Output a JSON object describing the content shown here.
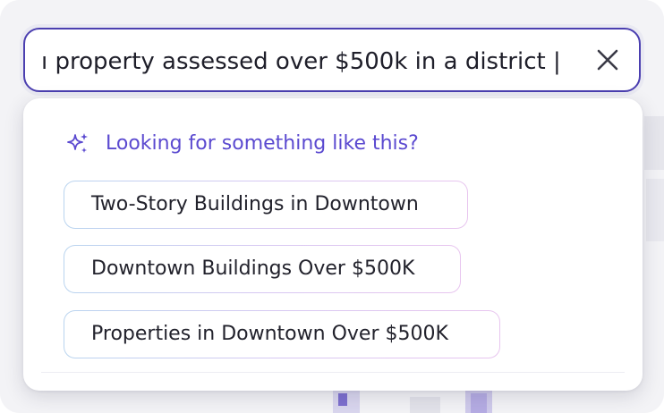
{
  "search": {
    "value": "ı property assessed over $500k in a district |"
  },
  "icons": {
    "clear": "close-icon",
    "suggest": "sparkle-icon"
  },
  "suggestions": {
    "title": "Looking for something like this?",
    "items": [
      {
        "label": "Two-Story Buildings in Downtown"
      },
      {
        "label": "Downtown Buildings Over $500K"
      },
      {
        "label": "Properties in Downtown Over $500K"
      }
    ]
  },
  "colors": {
    "accent": "#5b4ad0",
    "border": "#4b3fb0",
    "text": "#22222c"
  }
}
